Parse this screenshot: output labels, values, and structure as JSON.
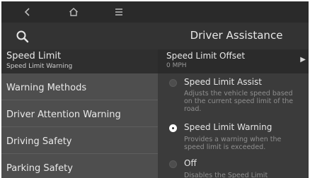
{
  "nav": {
    "back_icon": "back-chevron-icon",
    "home_icon": "home-icon",
    "menu_icon": "menu-icon"
  },
  "header": {
    "search_icon": "search-icon",
    "title": "Driver Assistance"
  },
  "sidebar": {
    "items": [
      {
        "label": "Speed Limit",
        "sublabel": "Speed Limit Warning",
        "selected": true
      },
      {
        "label": "Warning Methods"
      },
      {
        "label": "Driver Attention Warning"
      },
      {
        "label": "Driving Safety"
      },
      {
        "label": "Parking Safety"
      }
    ]
  },
  "panel": {
    "offset": {
      "title": "Speed Limit Offset",
      "value": "0 MPH"
    },
    "options": [
      {
        "title": "Speed Limit Assist",
        "desc": "Adjusts the vehicle speed based on the current speed limit of the road.",
        "selected": false
      },
      {
        "title": "Speed Limit Warning",
        "desc": "Provides a warning when the speed limit is exceeded.",
        "selected": true
      },
      {
        "title": "Off",
        "desc": "Disables the Speed Limit",
        "selected": false
      }
    ]
  }
}
